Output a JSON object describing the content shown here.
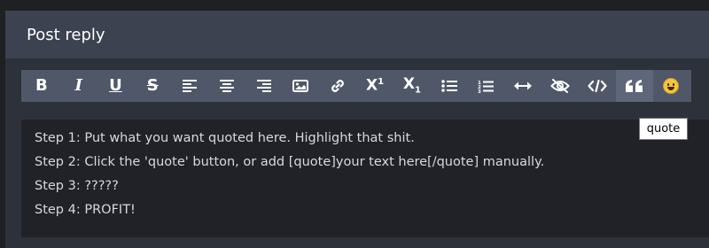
{
  "panel": {
    "title": "Post reply"
  },
  "toolbar": {
    "buttons": [
      {
        "name": "bold-button",
        "icon": "bold-icon"
      },
      {
        "name": "italic-button",
        "icon": "italic-icon"
      },
      {
        "name": "underline-button",
        "icon": "underline-icon"
      },
      {
        "name": "strikethrough-button",
        "icon": "strikethrough-icon"
      },
      {
        "name": "align-left-button",
        "icon": "align-left-icon"
      },
      {
        "name": "align-center-button",
        "icon": "align-center-icon"
      },
      {
        "name": "align-right-button",
        "icon": "align-right-icon"
      },
      {
        "name": "image-button",
        "icon": "image-icon"
      },
      {
        "name": "link-button",
        "icon": "link-icon"
      },
      {
        "name": "superscript-button",
        "icon": "superscript-icon"
      },
      {
        "name": "subscript-button",
        "icon": "subscript-icon"
      },
      {
        "name": "bullet-list-button",
        "icon": "bullet-list-icon"
      },
      {
        "name": "numbered-list-button",
        "icon": "numbered-list-icon"
      },
      {
        "name": "horizontal-rule-button",
        "icon": "horizontal-rule-icon"
      },
      {
        "name": "spoiler-button",
        "icon": "eye-slash-icon"
      },
      {
        "name": "code-button",
        "icon": "code-icon"
      },
      {
        "name": "quote-button",
        "icon": "quote-icon"
      },
      {
        "name": "emoji-button",
        "icon": "emoji-icon"
      }
    ],
    "tooltip": "quote"
  },
  "editor": {
    "lines": [
      "Step 1: Put what you want quoted here. Highlight that shit.",
      "Step 2: Click the 'quote' button, or add [quote]your text here[/quote] manually.",
      "Step 3: ?????",
      "Step 4: PROFIT!"
    ]
  },
  "colors": {
    "page_bg": "#1f2024",
    "header_bg": "#3c4250",
    "toolbar_bg": "#4f5769",
    "editor_bg": "#202227",
    "text": "#d7d9de"
  }
}
